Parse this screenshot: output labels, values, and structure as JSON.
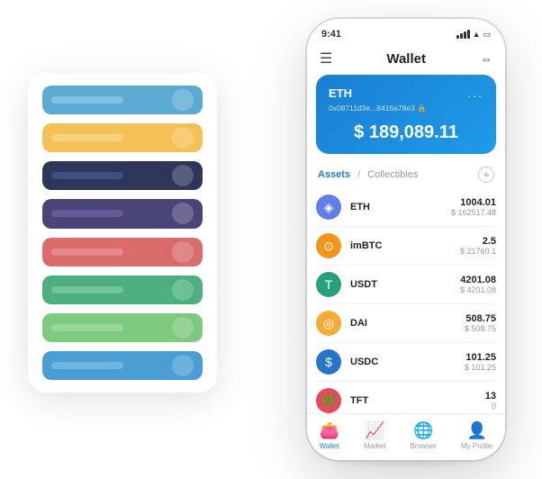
{
  "header": {
    "title": "Wallet",
    "time": "9:41",
    "menu_icon": "☰",
    "scan_icon": "⇔"
  },
  "eth_card": {
    "label": "ETH",
    "address": "0x08711d3e...8416a78e3 🔒",
    "balance": "$ 189,089.11",
    "currency_symbol": "$",
    "dots": "..."
  },
  "assets_tabs": {
    "active": "Assets",
    "divider": "/",
    "inactive": "Collectibles"
  },
  "assets": [
    {
      "name": "ETH",
      "amount": "1004.01",
      "usd": "$ 162517.48",
      "icon_color": "#627EEA",
      "icon_text": "◈"
    },
    {
      "name": "imBTC",
      "amount": "2.5",
      "usd": "$ 21760.1",
      "icon_color": "#F7931A",
      "icon_text": "⊙"
    },
    {
      "name": "USDT",
      "amount": "4201.08",
      "usd": "$ 4201.08",
      "icon_color": "#26A17B",
      "icon_text": "T"
    },
    {
      "name": "DAI",
      "amount": "508.75",
      "usd": "$ 508.75",
      "icon_color": "#F5AC37",
      "icon_text": "◎"
    },
    {
      "name": "USDC",
      "amount": "101.25",
      "usd": "$ 101.25",
      "icon_color": "#2775CA",
      "icon_text": "$"
    },
    {
      "name": "TFT",
      "amount": "13",
      "usd": "0",
      "icon_color": "#E8475F",
      "icon_text": "🌿"
    }
  ],
  "nav": [
    {
      "icon": "👛",
      "label": "Wallet",
      "active": true
    },
    {
      "icon": "📈",
      "label": "Market",
      "active": false
    },
    {
      "icon": "🌐",
      "label": "Browser",
      "active": false
    },
    {
      "icon": "👤",
      "label": "My Profile",
      "active": false
    }
  ],
  "bg_cards": [
    {
      "color": "#5BAAD4",
      "text_color": "#a0d4f0"
    },
    {
      "color": "#F5C055",
      "text_color": "#f9dfa0"
    },
    {
      "color": "#2D3559",
      "text_color": "#5060a0"
    },
    {
      "color": "#4A4579",
      "text_color": "#7a70b0"
    },
    {
      "color": "#D96B6B",
      "text_color": "#f0a0a0"
    },
    {
      "color": "#4CAF7D",
      "text_color": "#90d4b0"
    },
    {
      "color": "#7DC97D",
      "text_color": "#b0e0b0"
    },
    {
      "color": "#4A9ED4",
      "text_color": "#90c8f0"
    }
  ]
}
